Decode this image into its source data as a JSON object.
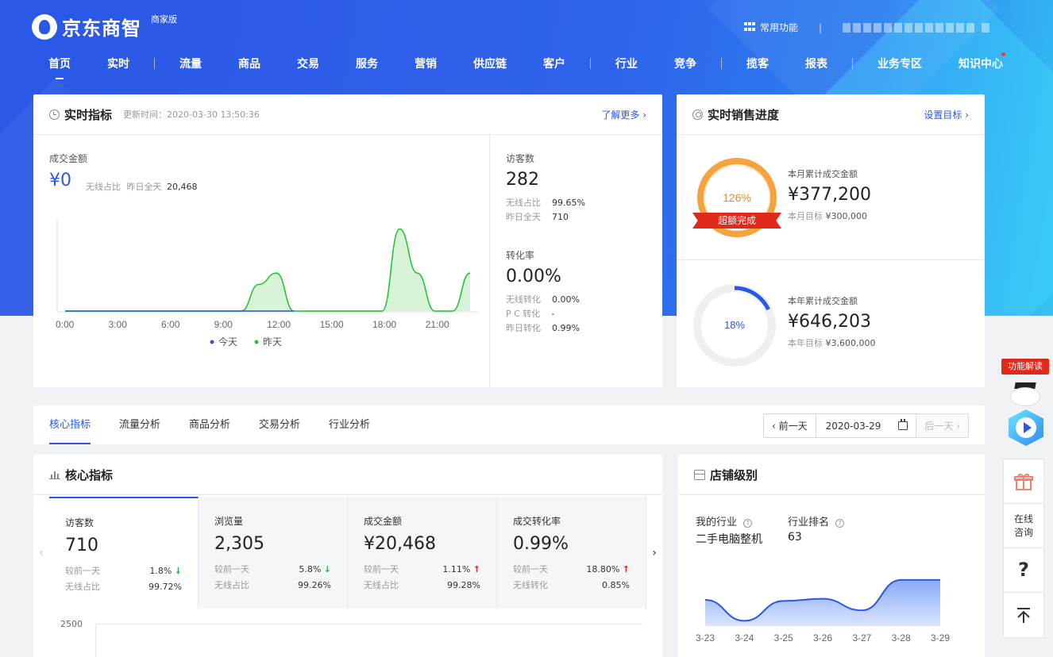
{
  "header": {
    "brand": "京东商智",
    "edition": "商家版",
    "common_functions": "常用功能",
    "nav": [
      {
        "label": "首页",
        "active": true
      },
      {
        "label": "实时"
      },
      {
        "label": "流量"
      },
      {
        "label": "商品"
      },
      {
        "label": "交易"
      },
      {
        "label": "服务"
      },
      {
        "label": "营销"
      },
      {
        "label": "供应链"
      },
      {
        "label": "客户"
      },
      {
        "label": "行业"
      },
      {
        "label": "竞争"
      },
      {
        "label": "揽客"
      },
      {
        "label": "报表"
      },
      {
        "label": "业务专区"
      },
      {
        "label": "知识中心",
        "has_dot": true
      }
    ]
  },
  "realtime": {
    "title": "实时指标",
    "update_time": "更新时间：2020-03-30 13:50:36",
    "more": "了解更多 ›",
    "gmv_label": "成交金额",
    "gmv_value": "¥0",
    "wireless_label": "无线占比",
    "yesterday_full_label": "昨日全天",
    "yesterday_full_value": "20,468",
    "visitors_label": "访客数",
    "visitors_value": "282",
    "visitors_wireless_label": "无线占比",
    "visitors_wireless_value": "99.65%",
    "visitors_yesterday_label": "昨日全天",
    "visitors_yesterday_value": "710",
    "conv_label": "转化率",
    "conv_value": "0.00%",
    "conv_wireless_label": "无线转化",
    "conv_wireless_value": "0.00%",
    "conv_pc_label": "P C 转化",
    "conv_pc_value": "-",
    "conv_yesterday_label": "昨日转化",
    "conv_yesterday_value": "0.99%"
  },
  "chart_data": {
    "type": "area",
    "x": [
      "0:00",
      "1:00",
      "2:00",
      "3:00",
      "4:00",
      "5:00",
      "6:00",
      "7:00",
      "8:00",
      "9:00",
      "10:00",
      "11:00",
      "12:00",
      "13:00",
      "14:00",
      "15:00",
      "16:00",
      "17:00",
      "18:00",
      "19:00",
      "20:00",
      "21:00",
      "22:00",
      "23:00"
    ],
    "xticks": [
      "0:00",
      "3:00",
      "6:00",
      "9:00",
      "12:00",
      "15:00",
      "18:00",
      "21:00"
    ],
    "series": [
      {
        "name": "今天",
        "color": "#2a57e6",
        "values": [
          0,
          0,
          0,
          0,
          0,
          0,
          0,
          0,
          0,
          0,
          0,
          0,
          0,
          0
        ]
      },
      {
        "name": "昨天",
        "color": "#22c02a",
        "values": [
          0,
          0,
          0,
          0,
          0,
          0,
          0,
          0,
          0,
          0,
          0,
          3500,
          5000,
          0,
          0,
          0,
          0,
          0,
          0,
          10800,
          5000,
          0,
          0,
          5000
        ]
      }
    ],
    "ylim": [
      0,
      12000
    ]
  },
  "sales_progress": {
    "title": "实时销售进度",
    "set_target": "设置目标 ›",
    "month": {
      "percent_label": "126%",
      "percent": 1.26,
      "ribbon": "超额完成",
      "label": "本月累计成交金额",
      "value": "¥377,200",
      "target_label": "本月目标",
      "target_value": "¥300,000"
    },
    "year": {
      "percent_label": "18%",
      "percent": 0.18,
      "label": "本年累计成交金额",
      "value": "¥646,203",
      "target_label": "本年目标",
      "target_value": "¥3,600,000"
    }
  },
  "tabs": {
    "items": [
      "核心指标",
      "流量分析",
      "商品分析",
      "交易分析",
      "行业分析"
    ],
    "prev_day": "‹ 前一天",
    "date": "2020-03-29",
    "next_day": "后一天 ›"
  },
  "core": {
    "title": "核心指标",
    "metrics": [
      {
        "name": "访客数",
        "value": "710",
        "cmp_label": "较前一天",
        "cmp_value": "1.8%",
        "trend": "down",
        "ratio_label": "无线占比",
        "ratio_value": "99.72%"
      },
      {
        "name": "浏览量",
        "value": "2,305",
        "cmp_label": "较前一天",
        "cmp_value": "5.8%",
        "trend": "down",
        "ratio_label": "无线占比",
        "ratio_value": "99.26%"
      },
      {
        "name": "成交金额",
        "value": "¥20,468",
        "cmp_label": "较前一天",
        "cmp_value": "1.11%",
        "trend": "up",
        "ratio_label": "无线占比",
        "ratio_value": "99.28%"
      },
      {
        "name": "成交转化率",
        "value": "0.99%",
        "cmp_label": "较前一天",
        "cmp_value": "18.80%",
        "trend": "up",
        "ratio_label": "无线转化",
        "ratio_value": "0.85%"
      }
    ],
    "y_top_tick": "2500"
  },
  "shop_level": {
    "title": "店铺级别",
    "industry_label": "我的行业",
    "industry_value": "二手电脑整机",
    "rank_label": "行业排名",
    "rank_value": "63",
    "dates": [
      "3-23",
      "3-24",
      "3-25",
      "3-26",
      "3-27",
      "3-28",
      "3-29"
    ],
    "values": [
      50,
      10,
      48,
      52,
      30,
      88,
      88
    ]
  },
  "side_tools": {
    "feature_intro": "功能解读",
    "online_consult": "在线\n咨询",
    "help": "?"
  }
}
